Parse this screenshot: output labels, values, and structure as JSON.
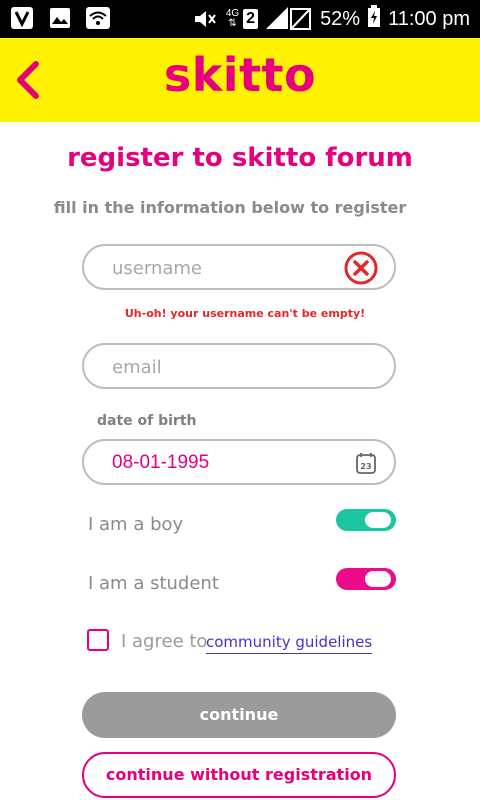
{
  "status_bar": {
    "network": "4G",
    "sim": "2",
    "battery": "52%",
    "time": "11:00 pm",
    "icons": [
      "v-app-icon",
      "gallery-icon",
      "wifi-icon",
      "mute-icon",
      "signal-icon",
      "battery-icon"
    ]
  },
  "header": {
    "logo": "skitto",
    "back_icon": "chevron-left-icon"
  },
  "page": {
    "title": "register to skitto forum",
    "subtitle": "fill in the information below to register"
  },
  "form": {
    "username": {
      "placeholder": "username",
      "value": "",
      "error": "Uh-oh! your username can't be empty!",
      "icon": "error-x-icon"
    },
    "email": {
      "placeholder": "email",
      "value": ""
    },
    "dob": {
      "label": "date of birth",
      "value": "08-01-1995",
      "icon": "calendar-icon",
      "calendar_day": "23"
    },
    "toggles": [
      {
        "label": "I am a boy",
        "on": true,
        "color": "#1bc6a0"
      },
      {
        "label": "I am a student",
        "on": true,
        "color": "#ee0a8b"
      }
    ],
    "agree": {
      "text": "I agree to",
      "link": "community guidelines",
      "checked": false
    }
  },
  "buttons": {
    "continue": "continue",
    "continue_without": "continue without registration"
  },
  "colors": {
    "brand": "#e6007e",
    "header_bg": "#fff200",
    "error": "#e5262b",
    "link": "#4a32c8",
    "disabled_button": "#9b9b9b"
  }
}
